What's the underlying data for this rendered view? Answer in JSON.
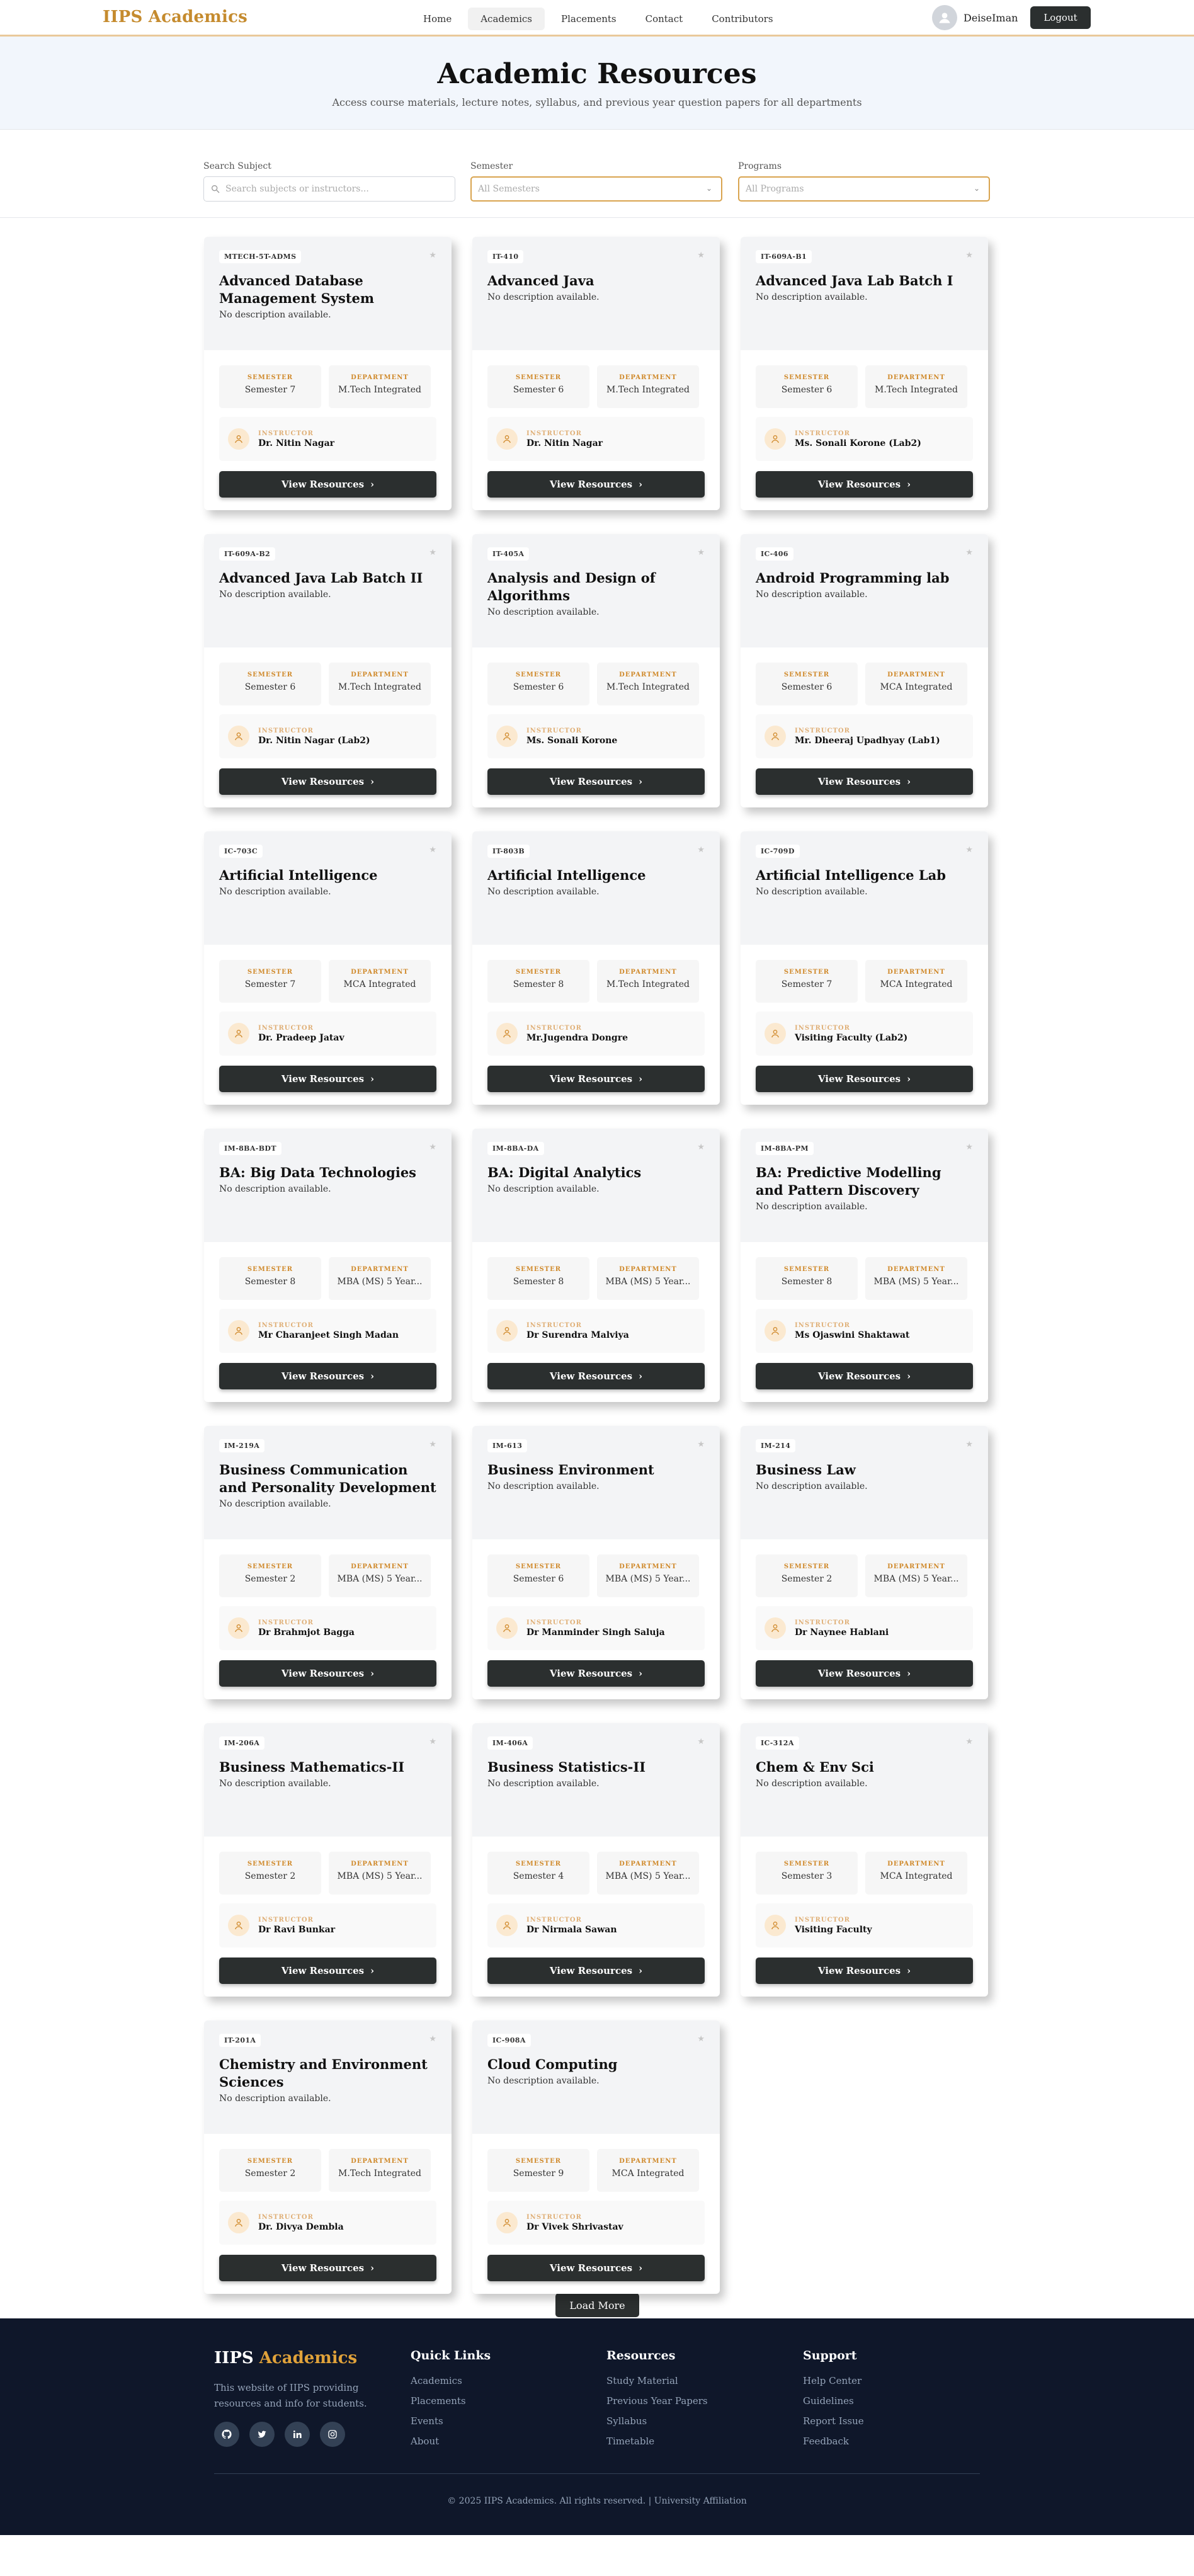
{
  "header": {
    "brand": "IIPS Academics",
    "nav": [
      "Home",
      "Academics",
      "Placements",
      "Contact",
      "Contributors"
    ],
    "active_nav": "Academics",
    "username": "DeiseIman",
    "logout": "Logout"
  },
  "hero": {
    "title": "Academic Resources",
    "subtitle": "Access course materials, lecture notes, syllabus, and previous year question papers for all departments"
  },
  "filters": {
    "subject_label": "Search Subject",
    "subject_placeholder": "Search subjects or instructors...",
    "semester_label": "Semester",
    "semester_value": "All Semesters",
    "programs_label": "Programs",
    "programs_value": "All Programs"
  },
  "labels": {
    "semester": "SEMESTER",
    "department": "DEPARTMENT",
    "instructor": "INSTRUCTOR",
    "view": "View Resources"
  },
  "courses": [
    {
      "code": "MTECH-5T-ADMS",
      "title": "Advanced Database Management System",
      "desc": "No description available.",
      "semester": "Semester 7",
      "department": "M.Tech Integrated",
      "instructor": "Dr. Nitin Nagar"
    },
    {
      "code": "IT-410",
      "title": "Advanced Java",
      "desc": "No description available.",
      "semester": "Semester 6",
      "department": "M.Tech Integrated",
      "instructor": "Dr. Nitin Nagar"
    },
    {
      "code": "IT-609A-B1",
      "title": "Advanced Java Lab Batch I",
      "desc": "No description available.",
      "semester": "Semester 6",
      "department": "M.Tech Integrated",
      "instructor": "Ms. Sonali Korone (Lab2)"
    },
    {
      "code": "IT-609A-B2",
      "title": "Advanced Java Lab Batch II",
      "desc": "No description available.",
      "semester": "Semester 6",
      "department": "M.Tech Integrated",
      "instructor": "Dr. Nitin Nagar (Lab2)"
    },
    {
      "code": "IT-405A",
      "title": "Analysis and Design of Algorithms",
      "desc": "No description available.",
      "semester": "Semester 6",
      "department": "M.Tech Integrated",
      "instructor": "Ms. Sonali Korone"
    },
    {
      "code": "IC-406",
      "title": "Android Programming lab",
      "desc": "No description available.",
      "semester": "Semester 6",
      "department": "MCA Integrated",
      "instructor": "Mr. Dheeraj Upadhyay (Lab1)"
    },
    {
      "code": "IC-703C",
      "title": "Artificial Intelligence",
      "desc": "No description available.",
      "semester": "Semester 7",
      "department": "MCA Integrated",
      "instructor": "Dr. Pradeep Jatav"
    },
    {
      "code": "IT-803B",
      "title": "Artificial Intelligence",
      "desc": "No description available.",
      "semester": "Semester 8",
      "department": "M.Tech Integrated",
      "instructor": "Mr.Jugendra Dongre"
    },
    {
      "code": "IC-709D",
      "title": "Artificial Intelligence Lab",
      "desc": "No description available.",
      "semester": "Semester 7",
      "department": "MCA Integrated",
      "instructor": "Visiting Faculty (Lab2)"
    },
    {
      "code": "IM-8BA-BDT",
      "title": "BA: Big Data Technologies",
      "desc": "No description available.",
      "semester": "Semester 8",
      "department": "MBA (MS) 5 Year...",
      "instructor": "Mr Charanjeet Singh Madan"
    },
    {
      "code": "IM-8BA-DA",
      "title": "BA: Digital Analytics",
      "desc": "No description available.",
      "semester": "Semester 8",
      "department": "MBA (MS) 5 Year...",
      "instructor": "Dr Surendra Malviya"
    },
    {
      "code": "IM-8BA-PM",
      "title": "BA: Predictive Modelling and Pattern Discovery",
      "desc": "No description available.",
      "semester": "Semester 8",
      "department": "MBA (MS) 5 Year...",
      "instructor": "Ms Ojaswini Shaktawat"
    },
    {
      "code": "IM-219A",
      "title": "Business Communication and Personality Development",
      "desc": "No description available.",
      "semester": "Semester 2",
      "department": "MBA (MS) 5 Year...",
      "instructor": "Dr Brahmjot Bagga"
    },
    {
      "code": "IM-613",
      "title": "Business Environment",
      "desc": "No description available.",
      "semester": "Semester 6",
      "department": "MBA (MS) 5 Year...",
      "instructor": "Dr Manminder Singh Saluja"
    },
    {
      "code": "IM-214",
      "title": "Business Law",
      "desc": "No description available.",
      "semester": "Semester 2",
      "department": "MBA (MS) 5 Year...",
      "instructor": "Dr Naynee Hablani"
    },
    {
      "code": "IM-206A",
      "title": "Business Mathematics-II",
      "desc": "No description available.",
      "semester": "Semester 2",
      "department": "MBA (MS) 5 Year...",
      "instructor": "Dr Ravi Bunkar"
    },
    {
      "code": "IM-406A",
      "title": "Business Statistics-II",
      "desc": "No description available.",
      "semester": "Semester 4",
      "department": "MBA (MS) 5 Year...",
      "instructor": "Dr Nirmala Sawan"
    },
    {
      "code": "IC-312A",
      "title": "Chem & Env Sci",
      "desc": "No description available.",
      "semester": "Semester 3",
      "department": "MCA Integrated",
      "instructor": "Visiting Faculty"
    },
    {
      "code": "IT-201A",
      "title": "Chemistry and Environment Sciences",
      "desc": "No description available.",
      "semester": "Semester 2",
      "department": "M.Tech Integrated",
      "instructor": "Dr. Divya Dembla"
    },
    {
      "code": "IC-908A",
      "title": "Cloud Computing",
      "desc": "No description available.",
      "semester": "Semester 9",
      "department": "MCA Integrated",
      "instructor": "Dr Vivek Shrivastav"
    }
  ],
  "load_more": "Load More",
  "footer": {
    "brand_a": "IIPS",
    "brand_b": "Academics",
    "about": "This website of IIPS providing resources and info for students.",
    "social": [
      "github-icon",
      "twitter-icon",
      "linkedin-icon",
      "instagram-icon"
    ],
    "quick_links_title": "Quick Links",
    "quick_links": [
      "Academics",
      "Placements",
      "Events",
      "About"
    ],
    "resources_title": "Resources",
    "resources": [
      "Study Material",
      "Previous Year Papers",
      "Syllabus",
      "Timetable"
    ],
    "support_title": "Support",
    "support": [
      "Help Center",
      "Guidelines",
      "Report Issue",
      "Feedback"
    ],
    "copyright": "© 2025 IIPS Academics. All rights reserved. | University Affiliation"
  }
}
